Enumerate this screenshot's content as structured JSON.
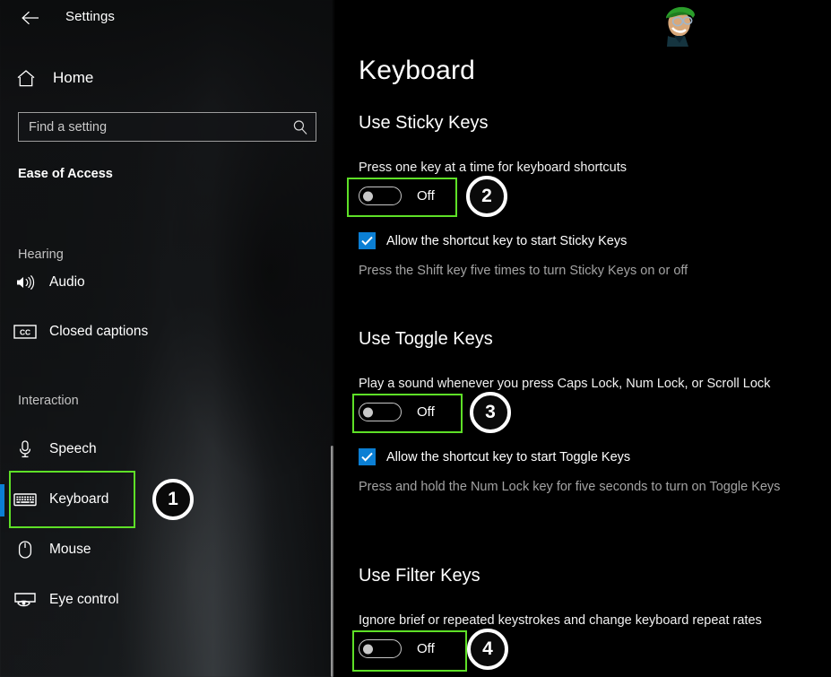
{
  "window": {
    "title": "Settings",
    "back_icon": "back-arrow-icon"
  },
  "sidebar": {
    "home": {
      "label": "Home",
      "icon": "home-icon"
    },
    "search": {
      "placeholder": "Find a setting",
      "value": "",
      "icon": "search-icon"
    },
    "group_title": "Ease of Access",
    "sections": [
      {
        "title": "Hearing",
        "items": [
          {
            "label": "Audio",
            "icon": "audio-speaker-icon",
            "selected": false
          },
          {
            "label": "Closed captions",
            "icon": "closed-captions-icon",
            "selected": false
          }
        ]
      },
      {
        "title": "Interaction",
        "items": [
          {
            "label": "Speech",
            "icon": "microphone-icon",
            "selected": false
          },
          {
            "label": "Keyboard",
            "icon": "keyboard-icon",
            "selected": true
          },
          {
            "label": "Mouse",
            "icon": "mouse-icon",
            "selected": false
          },
          {
            "label": "Eye control",
            "icon": "eye-control-icon",
            "selected": false
          }
        ]
      }
    ]
  },
  "main": {
    "avatar": "user-avatar-cartoon",
    "page_title": "Keyboard",
    "sections": [
      {
        "heading": "Use Sticky Keys",
        "description": "Press one key at a time for keyboard shortcuts",
        "toggle_state": "Off",
        "checkbox_label": "Allow the shortcut key to start Sticky Keys",
        "checkbox_checked": true,
        "hint": "Press the Shift key five times to turn Sticky Keys on or off"
      },
      {
        "heading": "Use Toggle Keys",
        "description": "Play a sound whenever you press Caps Lock, Num Lock, or Scroll Lock",
        "toggle_state": "Off",
        "checkbox_label": "Allow the shortcut key to start Toggle Keys",
        "checkbox_checked": true,
        "hint": "Press and hold the Num Lock key for five seconds to turn on Toggle Keys"
      },
      {
        "heading": "Use Filter Keys",
        "description": "Ignore brief or repeated keystrokes and change keyboard repeat rates",
        "toggle_state": "Off"
      }
    ]
  },
  "annotations": {
    "box_color": "#5ee027",
    "circle_border_color": "#ffffff",
    "markers": [
      {
        "number": "1",
        "target": "sidebar-item-keyboard"
      },
      {
        "number": "2",
        "target": "sticky-keys-toggle"
      },
      {
        "number": "3",
        "target": "toggle-keys-toggle"
      },
      {
        "number": "4",
        "target": "filter-keys-toggle"
      }
    ]
  },
  "colors": {
    "accent": "#0b7fd4",
    "sidebar_bg": "#2a2c2e",
    "main_bg": "#000000"
  }
}
